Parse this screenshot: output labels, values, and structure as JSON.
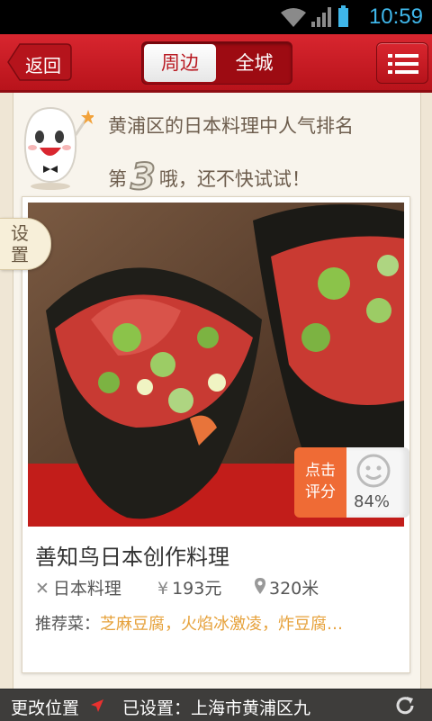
{
  "status_bar": {
    "time": "10:59"
  },
  "header": {
    "back_label": "返回",
    "tabs": [
      {
        "label": "周边",
        "active": true
      },
      {
        "label": "全城",
        "active": false
      }
    ]
  },
  "promo": {
    "line1": "黄浦区的日本料理中人气排名",
    "line2_prefix": "第",
    "rank": "3",
    "line2_suffix": "哦，还不快试试！"
  },
  "settings_tab_label": "设置",
  "restaurant": {
    "name": "善知鸟日本创作料理",
    "category": "日本料理",
    "price": "193元",
    "distance": "320米",
    "recommend_label": "推荐菜：",
    "recommend_dishes": "芝麻豆腐，火焰冰激凌，炸豆腐…",
    "rate_label": "点击评分",
    "rating": "84%"
  },
  "bottom_bar": {
    "change_location": "更改位置",
    "current_location": "已设置：上海市黄浦区九"
  },
  "colors": {
    "brand_red": "#c51c24",
    "accent_orange": "#ef6b35",
    "dish_color": "#e6a13a"
  }
}
